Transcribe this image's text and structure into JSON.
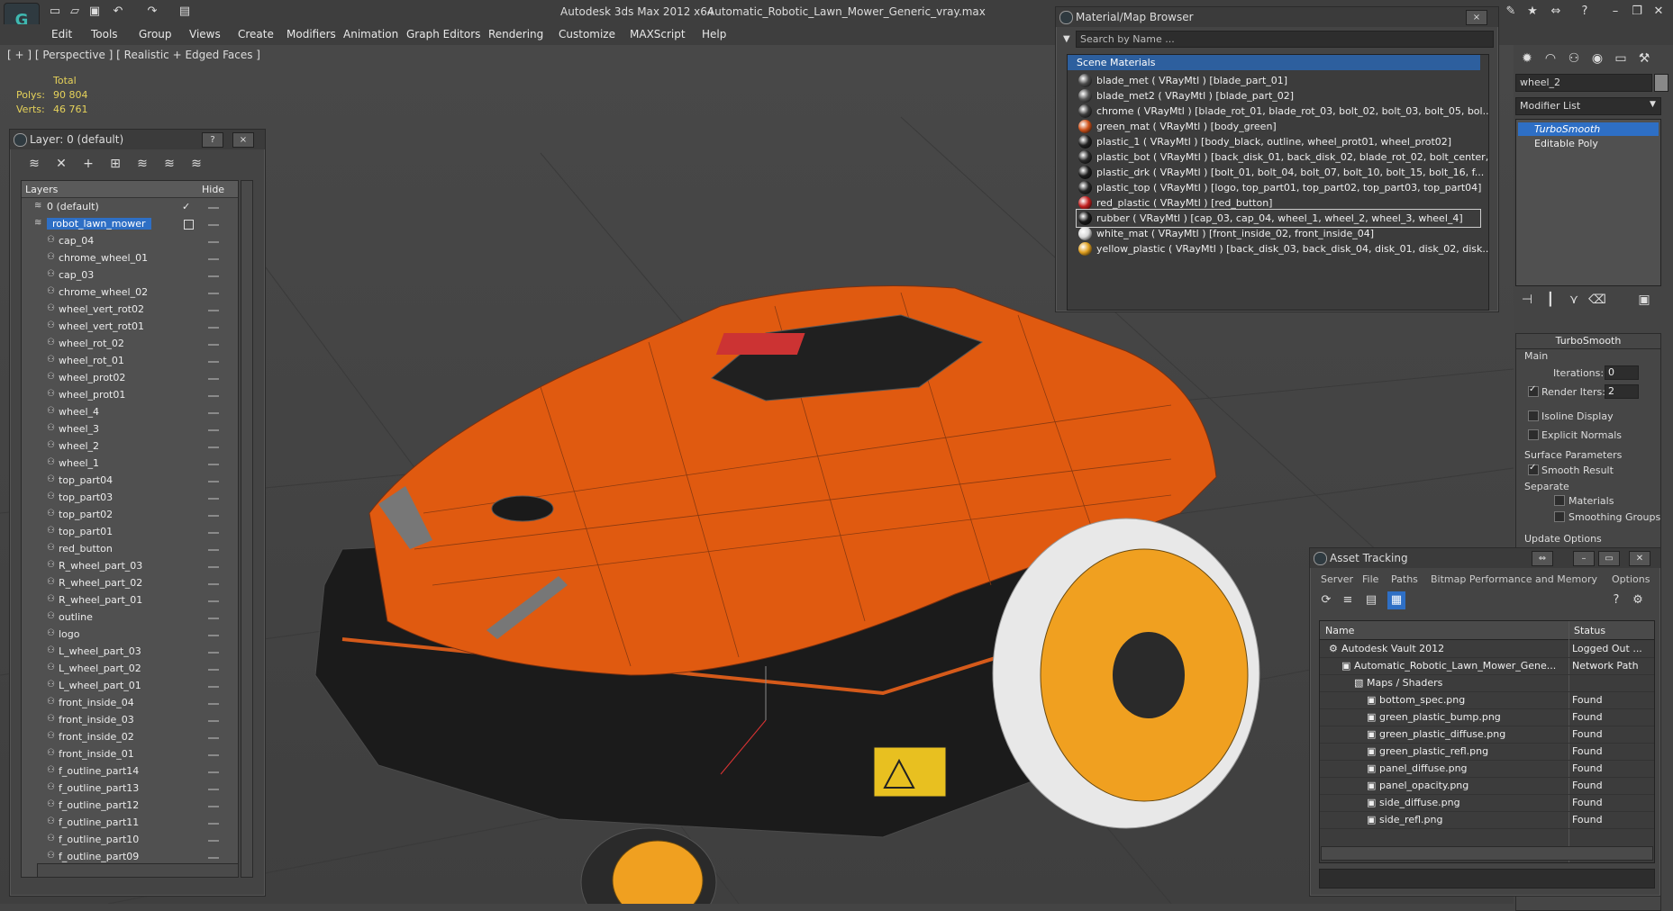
{
  "app": {
    "title": "Autodesk 3ds Max  2012 x64",
    "file": "Automatic_Robotic_Lawn_Mower_Generic_vray.max",
    "logo": "3ds-max-logo"
  },
  "menu": [
    "Edit",
    "Tools",
    "Group",
    "Views",
    "Create",
    "Modifiers",
    "Animation",
    "Graph Editors",
    "Rendering",
    "Customize",
    "MAXScript",
    "Help"
  ],
  "viewport": {
    "label": "[ + ] [ Perspective ] [ Realistic + Edged Faces ]",
    "stats": {
      "total_label": "Total",
      "polys_label": "Polys:",
      "polys": "90 804",
      "verts_label": "Verts:",
      "verts": "46 761"
    }
  },
  "layer_manager": {
    "title": "Layer: 0 (default)",
    "help_btn": "?",
    "close_btn": "×",
    "col_layers": "Layers",
    "col_hide": "Hide",
    "rows": [
      "0 (default)",
      "robot_lawn_mower",
      "cap_04",
      "chrome_wheel_01",
      "cap_03",
      "chrome_wheel_02",
      "wheel_vert_rot02",
      "wheel_vert_rot01",
      "wheel_rot_02",
      "wheel_rot_01",
      "wheel_prot02",
      "wheel_prot01",
      "wheel_4",
      "wheel_3",
      "wheel_2",
      "wheel_1",
      "top_part04",
      "top_part03",
      "top_part02",
      "top_part01",
      "red_button",
      "R_wheel_part_03",
      "R_wheel_part_02",
      "R_wheel_part_01",
      "outline",
      "logo",
      "L_wheel_part_03",
      "L_wheel_part_02",
      "L_wheel_part_01",
      "front_inside_04",
      "front_inside_03",
      "front_inside_02",
      "front_inside_01",
      "f_outline_part14",
      "f_outline_part13",
      "f_outline_part12",
      "f_outline_part11",
      "f_outline_part10",
      "f_outline_part09"
    ]
  },
  "material_browser": {
    "title": "Material/Map Browser",
    "close_btn": "×",
    "search_placeholder": "Search by Name ...",
    "group": "Scene Materials",
    "materials": [
      {
        "label": "blade_met  ( VRayMtl ) [blade_part_01]",
        "color": "#4a4a4a"
      },
      {
        "label": "blade_met2  ( VRayMtl ) [blade_part_02]",
        "color": "#555555"
      },
      {
        "label": "chrome  ( VRayMtl ) [blade_rot_01, blade_rot_03, bolt_02, bolt_03, bolt_05, bol...",
        "color": "#3a3a3a"
      },
      {
        "label": "green_mat  ( VRayMtl ) [body_green]",
        "color": "#d0531c"
      },
      {
        "label": "plastic_1  ( VRayMtl ) [body_black, outline, wheel_prot01, wheel_prot02]",
        "color": "#222222"
      },
      {
        "label": "plastic_bot  ( VRayMtl ) [back_disk_01, back_disk_02, blade_rot_02, bolt_center,...",
        "color": "#2a2a2a"
      },
      {
        "label": "plastic_drk  ( VRayMtl ) [bolt_01, bolt_04, bolt_07, bolt_10, bolt_15, bolt_16, f...",
        "color": "#1e1e1e"
      },
      {
        "label": "plastic_top  ( VRayMtl ) [logo, top_part01, top_part02, top_part03, top_part04]",
        "color": "#262626"
      },
      {
        "label": "red_plastic  ( VRayMtl ) [red_button]",
        "color": "#c22020"
      },
      {
        "label": "rubber  ( VRayMtl ) [cap_03, cap_04, wheel_1, wheel_2, wheel_3, wheel_4]",
        "color": "#1a1a1a"
      },
      {
        "label": "white_mat  ( VRayMtl ) [front_inside_02, front_inside_04]",
        "color": "#d8d8d8"
      },
      {
        "label": "yellow_plastic  ( VRayMtl ) [back_disk_03, back_disk_04, disk_01, disk_02, disk...",
        "color": "#e0a020"
      }
    ]
  },
  "command_panel": {
    "object_name": "wheel_2",
    "modifier_list": "Modifier List",
    "stack": [
      "TurboSmooth",
      "Editable Poly"
    ],
    "rollout_title": "TurboSmooth",
    "main_label": "Main",
    "iterations_label": "Iterations:",
    "iterations": "0",
    "render_iters_label": "Render Iters:",
    "render_iters": "2",
    "isoline_label": "Isoline Display",
    "explicit_label": "Explicit Normals",
    "surface_label": "Surface Parameters",
    "smooth_label": "Smooth Result",
    "separate_label": "Separate",
    "materials_label": "Materials",
    "smoothing_label": "Smoothing Groups",
    "update_label": "Update Options"
  },
  "asset_tracking": {
    "title": "Asset Tracking",
    "menus": [
      "Server",
      "File",
      "Paths",
      "Bitmap Performance and Memory",
      "Options"
    ],
    "col_name": "Name",
    "col_status": "Status",
    "rows": [
      {
        "name": "Autodesk Vault 2012",
        "status": "Logged Out ...",
        "indent": 0
      },
      {
        "name": "Automatic_Robotic_Lawn_Mower_Gene...",
        "status": "Network Path",
        "indent": 1
      },
      {
        "name": "Maps / Shaders",
        "status": "",
        "indent": 2
      },
      {
        "name": "bottom_spec.png",
        "status": "Found",
        "indent": 3
      },
      {
        "name": "green_plastic_bump.png",
        "status": "Found",
        "indent": 3
      },
      {
        "name": "green_plastic_diffuse.png",
        "status": "Found",
        "indent": 3
      },
      {
        "name": "green_plastic_refl.png",
        "status": "Found",
        "indent": 3
      },
      {
        "name": "panel_diffuse.png",
        "status": "Found",
        "indent": 3
      },
      {
        "name": "panel_opacity.png",
        "status": "Found",
        "indent": 3
      },
      {
        "name": "side_diffuse.png",
        "status": "Found",
        "indent": 3
      },
      {
        "name": "side_refl.png",
        "status": "Found",
        "indent": 3
      }
    ]
  }
}
